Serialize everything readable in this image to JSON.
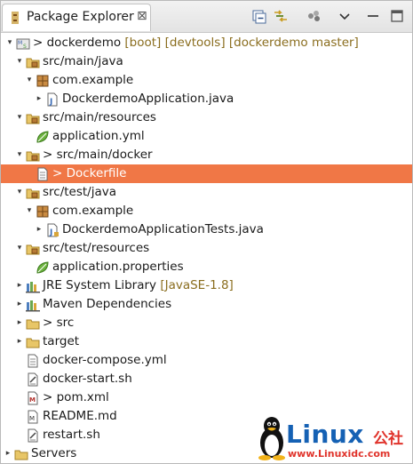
{
  "view": {
    "tab_title": "Package Explorer",
    "close_glyph": "⊠",
    "toolbar": [
      {
        "name": "collapse-all-icon"
      },
      {
        "name": "link-with-editor-icon"
      },
      {
        "name": "focus-on-active-task-icon"
      },
      {
        "name": "view-menu-chevron-icon"
      }
    ]
  },
  "tree": [
    {
      "label": "dockerdemo",
      "prefix": "> ",
      "deco": " [boot] [devtools] [dockerdemo master]",
      "icon": "project-icon",
      "expander": "open"
    },
    {
      "label": "src/main/java",
      "icon": "source-folder-icon",
      "expander": "open"
    },
    {
      "label": "com.example",
      "icon": "package-icon",
      "expander": "open"
    },
    {
      "label": "DockerdemoApplication.java",
      "icon": "java-file-icon",
      "expander": "closed"
    },
    {
      "label": "src/main/resources",
      "icon": "source-folder-icon",
      "expander": "open"
    },
    {
      "label": "application.yml",
      "icon": "spring-leaf-icon",
      "expander": "none"
    },
    {
      "label": "src/main/docker",
      "prefix": "> ",
      "icon": "source-folder-icon",
      "expander": "open"
    },
    {
      "label": "Dockerfile",
      "prefix": "> ",
      "icon": "text-file-icon",
      "expander": "none",
      "selected": true
    },
    {
      "label": "src/test/java",
      "icon": "source-folder-icon",
      "expander": "open"
    },
    {
      "label": "com.example",
      "icon": "package-icon",
      "expander": "open"
    },
    {
      "label": "DockerdemoApplicationTests.java",
      "icon": "java-test-file-icon",
      "expander": "closed"
    },
    {
      "label": "src/test/resources",
      "icon": "source-folder-icon",
      "expander": "open"
    },
    {
      "label": "application.properties",
      "icon": "spring-leaf-icon",
      "expander": "none"
    },
    {
      "label": "JRE System Library",
      "deco": " [JavaSE-1.8]",
      "icon": "library-icon",
      "expander": "closed"
    },
    {
      "label": "Maven Dependencies",
      "icon": "library-icon",
      "expander": "closed"
    },
    {
      "label": "src",
      "prefix": "> ",
      "icon": "folder-icon",
      "expander": "closed"
    },
    {
      "label": "target",
      "icon": "folder-icon",
      "expander": "closed"
    },
    {
      "label": "docker-compose.yml",
      "icon": "text-file-icon",
      "expander": "none"
    },
    {
      "label": "docker-start.sh",
      "icon": "script-file-icon",
      "expander": "none"
    },
    {
      "label": "pom.xml",
      "prefix": "> ",
      "icon": "xml-file-icon",
      "expander": "none"
    },
    {
      "label": "README.md",
      "icon": "markdown-file-icon",
      "expander": "none"
    },
    {
      "label": "restart.sh",
      "icon": "script-file-icon",
      "expander": "none"
    },
    {
      "label": "Servers",
      "icon": "folder-icon",
      "expander": "closed"
    }
  ],
  "watermark": {
    "brand": "Linux",
    "cn": "公社",
    "url": "www.Linuxidc.com"
  },
  "colors": {
    "selection": "#f07746",
    "decoration": "#8a6d1e",
    "brand_blue": "#1561b4",
    "brand_red": "#e0332b"
  }
}
